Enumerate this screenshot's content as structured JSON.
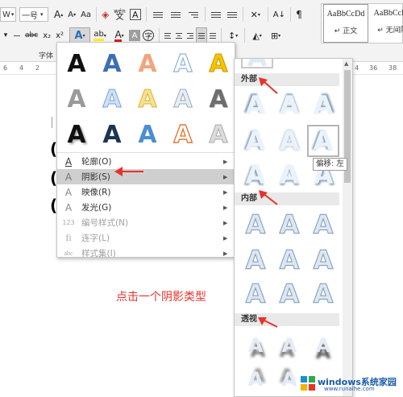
{
  "ribbon": {
    "font_name": "W",
    "font_size": "一号",
    "grow_font": "A",
    "shrink_font": "A",
    "change_case": "Aa",
    "clear_format": "A",
    "phonetic_top": "wén",
    "phonetic_char": "文",
    "char_border": "A",
    "sort": "A↓",
    "pilcrow": "¶",
    "strike": "abc",
    "subscript": "x₂",
    "superscript": "x²",
    "text_effects": "A",
    "highlight": "ab",
    "font_color": "A",
    "char_shading": "A",
    "enclose": "字",
    "group_label": "字体",
    "styles": [
      {
        "sample": "AaBbCcDd",
        "name": "↵ 正文"
      },
      {
        "sample": "AaBbCcDd",
        "name": "↵ 无间隔"
      }
    ]
  },
  "ruler": {
    "marks": [
      "6",
      "4",
      "2",
      "4",
      "36",
      "38"
    ]
  },
  "effects_panel": {
    "tile_letter": "A",
    "menu": [
      {
        "icon": "A",
        "label": "轮廓(O)",
        "enabled": true,
        "active": false
      },
      {
        "icon": "A",
        "label": "阴影(S)",
        "enabled": true,
        "active": true
      },
      {
        "icon": "A",
        "label": "映像(R)",
        "enabled": true,
        "active": false
      },
      {
        "icon": "A",
        "label": "发光(G)",
        "enabled": true,
        "active": false
      },
      {
        "icon": "123",
        "label": "编号样式(N)",
        "enabled": false,
        "active": false
      },
      {
        "icon": "fi",
        "label": "连字(L)",
        "enabled": false,
        "active": false
      },
      {
        "icon": "abc",
        "label": "样式集(I)",
        "enabled": false,
        "active": false
      }
    ]
  },
  "shadow_gallery": {
    "tile_letter": "A",
    "sections": [
      "外部",
      "内部",
      "透视"
    ],
    "tooltip": "偏移: 左"
  },
  "annotation": {
    "caption": "点击一个阴影类型"
  },
  "watermark": {
    "brand": "windows系统家园",
    "url": "www.runaihe.com"
  },
  "colors": {
    "annotation_red": "#e8322a",
    "watermark_blue": "#1a5ca8",
    "ribbon_bg": "#f3f3f3"
  }
}
